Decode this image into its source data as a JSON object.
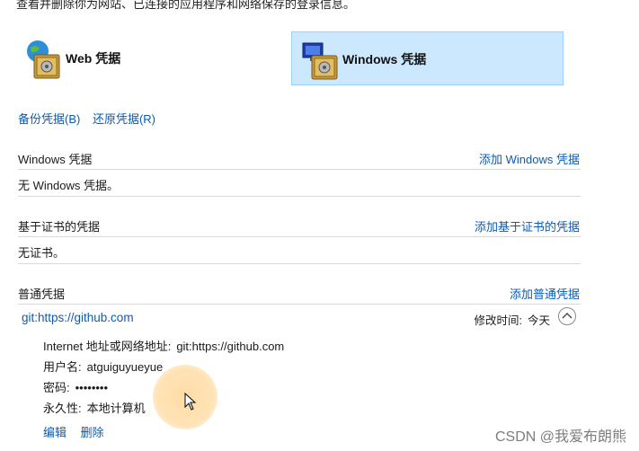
{
  "intro_text": "查看并删除你为网站、已连接的应用程序和网络保存的登录信息。",
  "tabs": [
    {
      "label": "Web 凭据",
      "selected": false
    },
    {
      "label": "Windows 凭据",
      "selected": true
    }
  ],
  "backup_links": {
    "backup": "备份凭据(B)",
    "restore": "还原凭据(R)"
  },
  "sections": {
    "windows": {
      "title": "Windows 凭据",
      "add": "添加 Windows 凭据",
      "empty": "无 Windows 凭据。"
    },
    "cert": {
      "title": "基于证书的凭据",
      "add": "添加基于证书的凭据",
      "empty": "无证书。"
    },
    "generic": {
      "title": "普通凭据",
      "add": "添加普通凭据"
    }
  },
  "credential": {
    "name": "git:https://github.com",
    "modified_label": "修改时间:",
    "modified_value": "今天",
    "details": {
      "address_label": "Internet 地址或网络地址:",
      "address_value": "git:https://github.com",
      "username_label": "用户名:",
      "username_value": "atguiguyueyue",
      "password_label": "密码:",
      "password_value": "••••••••",
      "persistence_label": "永久性:",
      "persistence_value": "本地计算机"
    },
    "actions": {
      "edit": "编辑",
      "delete": "删除"
    }
  },
  "watermark": "CSDN @我爱布朗熊",
  "colors": {
    "link": "#0a5bb5",
    "selected_tile_bg": "#cce8ff",
    "selected_tile_border": "#99d1ff"
  }
}
